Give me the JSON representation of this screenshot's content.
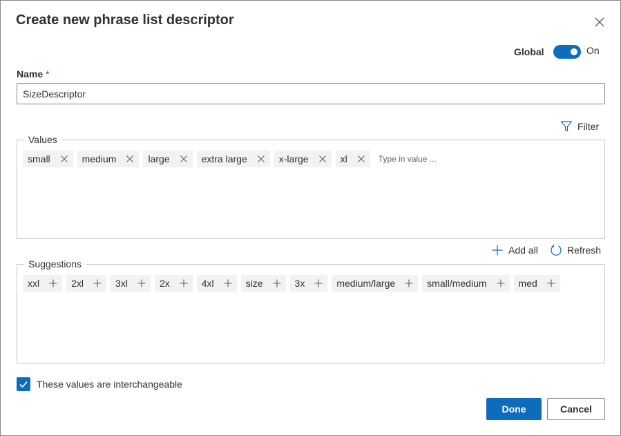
{
  "dialog": {
    "title": "Create new phrase list descriptor",
    "close_icon": "close-icon"
  },
  "global": {
    "label": "Global",
    "state_text": "On",
    "enabled": true
  },
  "name_field": {
    "label": "Name",
    "required_marker": "*",
    "value": "SizeDescriptor"
  },
  "filter": {
    "label": "Filter",
    "icon": "filter-icon"
  },
  "values": {
    "legend": "Values",
    "items": [
      {
        "label": "small"
      },
      {
        "label": "medium"
      },
      {
        "label": "large"
      },
      {
        "label": "extra large"
      },
      {
        "label": "x-large"
      },
      {
        "label": "xl"
      }
    ],
    "placeholder": "Type in value ..."
  },
  "actions": {
    "add_all_label": "Add all",
    "refresh_label": "Refresh"
  },
  "suggestions": {
    "legend": "Suggestions",
    "items": [
      {
        "label": "xxl"
      },
      {
        "label": "2xl"
      },
      {
        "label": "3xl"
      },
      {
        "label": "2x"
      },
      {
        "label": "4xl"
      },
      {
        "label": "size"
      },
      {
        "label": "3x"
      },
      {
        "label": "medium/large"
      },
      {
        "label": "small/medium"
      },
      {
        "label": "med"
      }
    ]
  },
  "interchangeable": {
    "label": "These values are interchangeable",
    "checked": true
  },
  "footer": {
    "done_label": "Done",
    "cancel_label": "Cancel"
  },
  "colors": {
    "accent": "#0f6cbd",
    "chip_bg": "#f3f2f1",
    "required": "#a4262c"
  }
}
